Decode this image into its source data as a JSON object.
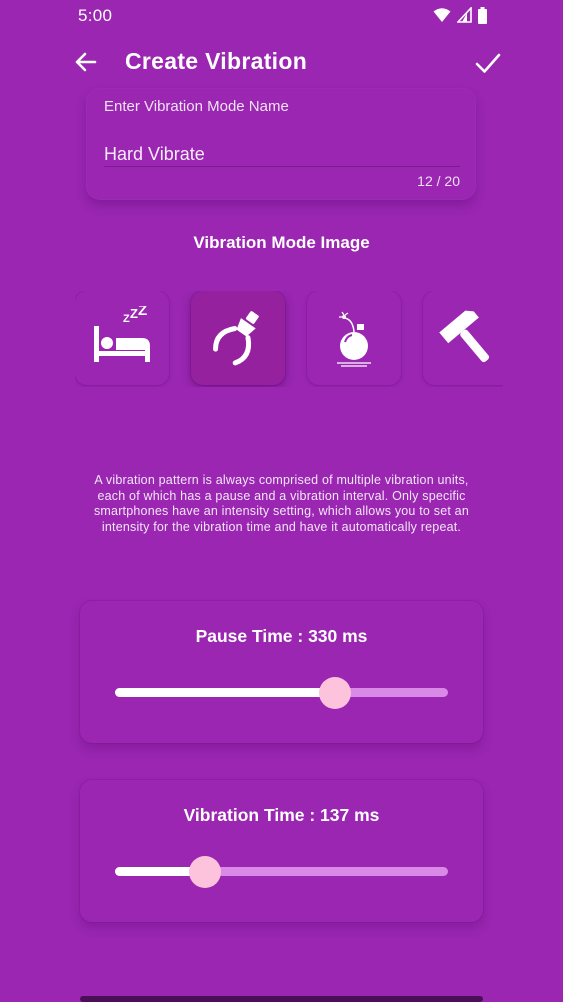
{
  "status_bar": {
    "time": "5:00",
    "icons": [
      "wifi-icon",
      "signal-icon",
      "battery-icon"
    ]
  },
  "app_bar": {
    "title": "Create Vibration",
    "back_icon": "arrow-left-icon",
    "confirm_icon": "check-icon"
  },
  "name_field": {
    "label": "Enter Vibration Mode Name",
    "value": "Hard Vibrate",
    "counter": "12 / 20"
  },
  "image_section": {
    "title": "Vibration Mode Image",
    "selected_index": 1,
    "images": [
      {
        "icon": "sleeping-bed-icon"
      },
      {
        "icon": "electric-plug-icon"
      },
      {
        "icon": "bomb-icon"
      },
      {
        "icon": "hammer-icon"
      }
    ]
  },
  "description": "A vibration pattern is always comprised of multiple vibration units, each of which has a pause and a vibration interval. Only specific smartphones have an intensity setting, which allows you to set an intensity for the vibration time and have it automatically repeat.",
  "pause_slider": {
    "title": "Pause Time : 330 ms",
    "fraction": 0.66
  },
  "vibration_slider": {
    "title": "Vibration Time : 137 ms",
    "fraction": 0.27
  },
  "colors": {
    "background": "#9a26b2",
    "track_inactive": "#d88ae6",
    "track_active": "#ffffff",
    "thumb": "#fdc2dc"
  }
}
